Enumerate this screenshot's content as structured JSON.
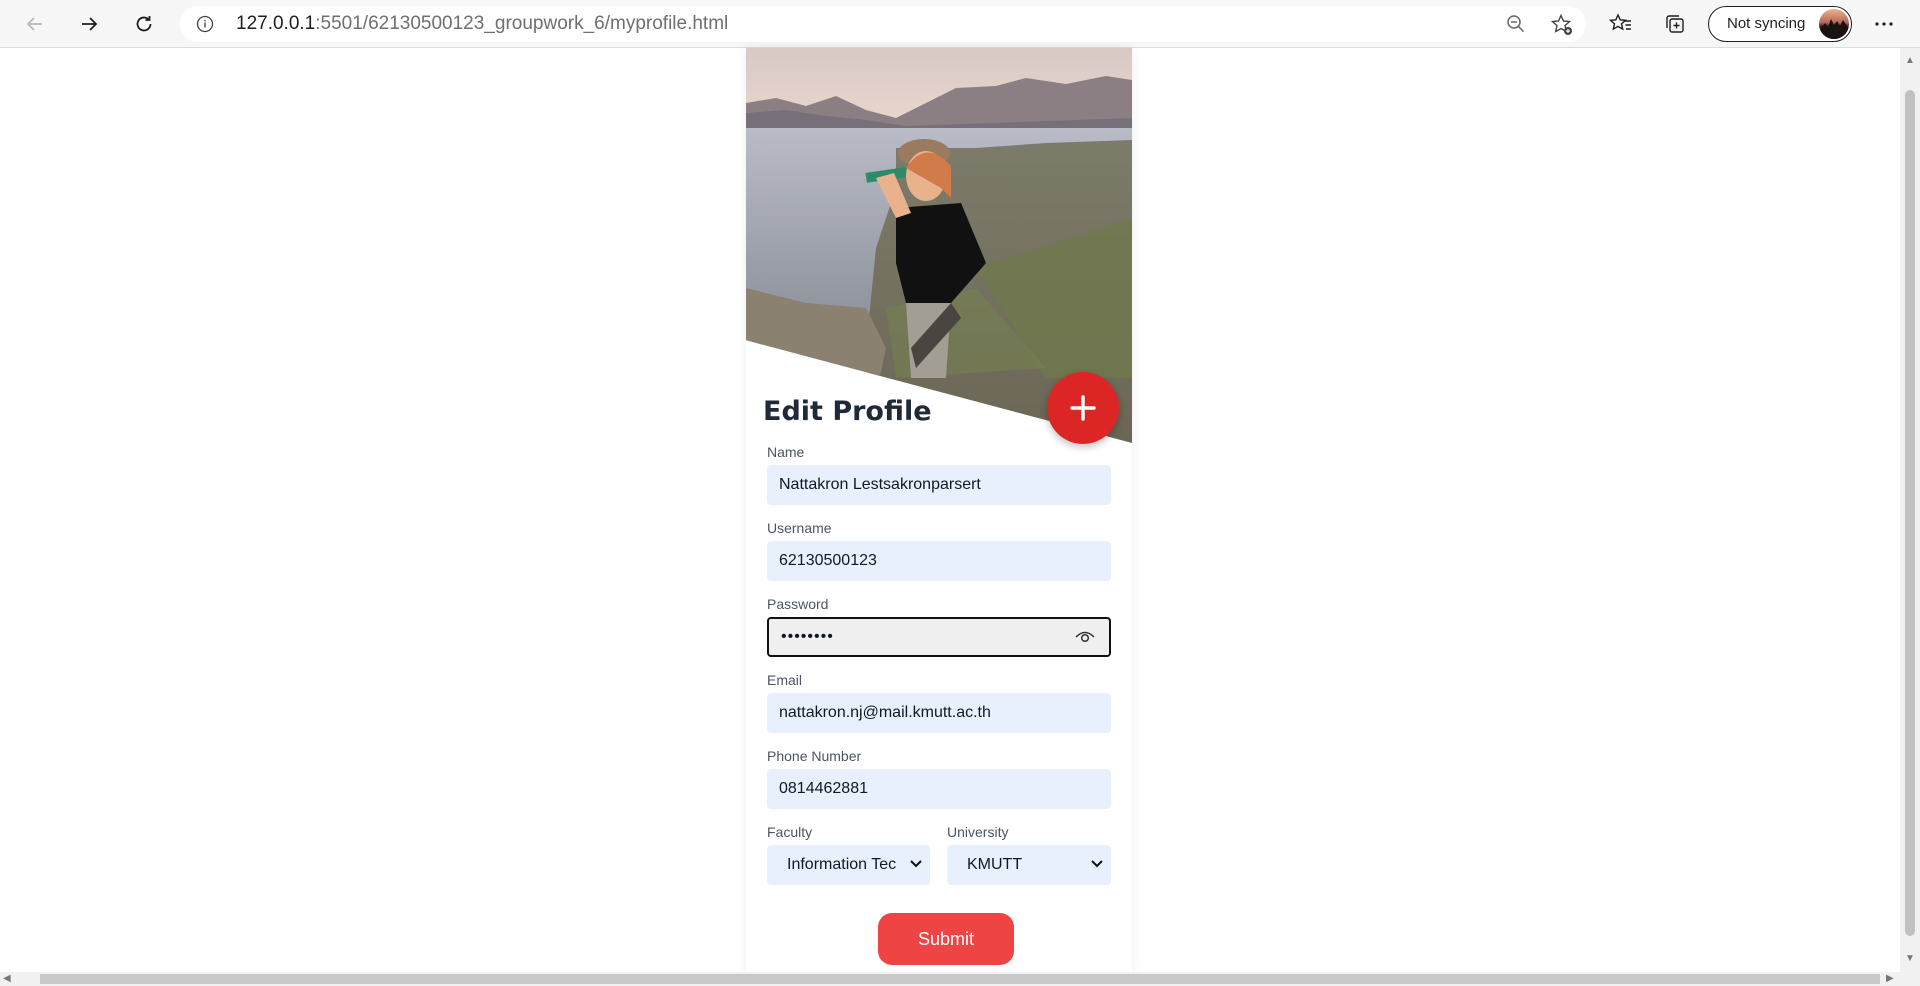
{
  "browser": {
    "url_host": "127.0.0.1",
    "url_rest": ":5501/62130500123_groupwork_6/myprofile.html",
    "sync_label": "Not syncing"
  },
  "profile": {
    "title": "Edit Profile",
    "fields": {
      "name": {
        "label": "Name",
        "value": "Nattakron Lestsakronparsert"
      },
      "username": {
        "label": "Username",
        "value": "62130500123"
      },
      "password": {
        "label": "Password",
        "value": "••••••••"
      },
      "email": {
        "label": "Email",
        "value": "nattakron.nj@mail.kmutt.ac.th"
      },
      "phone": {
        "label": "Phone Number",
        "value": "0814462881"
      },
      "faculty": {
        "label": "Faculty",
        "value": "Information Tec"
      },
      "university": {
        "label": "University",
        "value": "KMUTT"
      }
    },
    "submit_label": "Submit"
  },
  "colors": {
    "accent": "#dc2626",
    "submit": "#ef4444",
    "input_bg": "#e8f0fe"
  }
}
